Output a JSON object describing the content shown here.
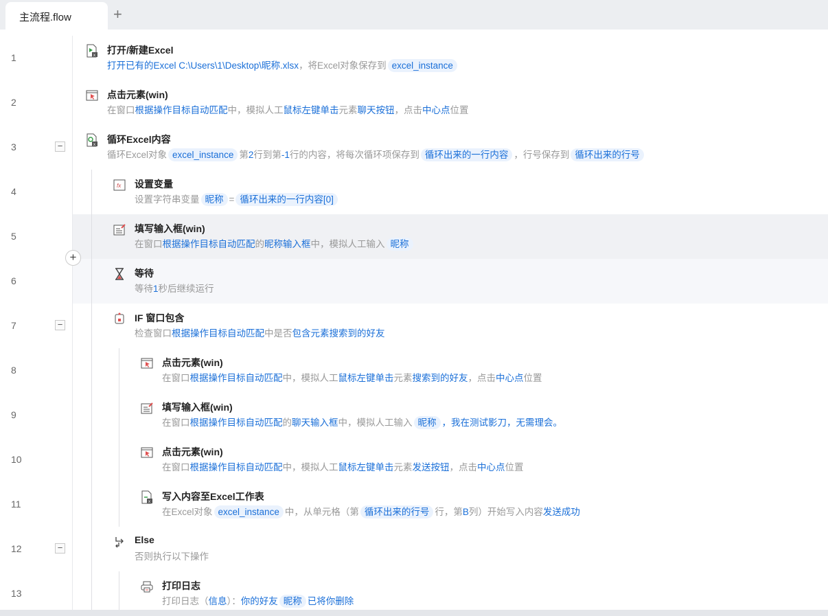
{
  "tabs": [
    {
      "label": "主流程.flow",
      "active": true
    }
  ],
  "add_tab_label": "+",
  "insert_button_label": "+",
  "collapse_label": "−",
  "colors": {
    "link": "#1a6fd8",
    "pill_bg": "#eaf2fd",
    "hover_row": "#f0f1f4",
    "selected_row": "#f6f7fa"
  },
  "steps": [
    {
      "line": "1",
      "level": 0,
      "icon": "excel-open-icon",
      "title": "打开/新建Excel",
      "desc": [
        [
          "b",
          "打开已有的Excel C:\\Users\\1\\Desktop\\昵称.xlsx"
        ],
        [
          "t",
          "，将Excel对象保存到"
        ],
        [
          "p",
          "excel_instance"
        ]
      ]
    },
    {
      "line": "2",
      "level": 0,
      "icon": "click-element-icon",
      "title": "点击元素(win)",
      "desc": [
        [
          "t",
          "在窗口"
        ],
        [
          "b",
          "根据操作目标自动匹配"
        ],
        [
          "t",
          "中，模拟人工"
        ],
        [
          "b",
          "鼠标左键单击"
        ],
        [
          "t",
          "元素"
        ],
        [
          "b",
          "聊天按钮"
        ],
        [
          "t",
          "，点击"
        ],
        [
          "b",
          "中心点"
        ],
        [
          "t",
          "位置"
        ]
      ]
    },
    {
      "line": "3",
      "level": 0,
      "icon": "excel-loop-icon",
      "title": "循环Excel内容",
      "collapsible": true,
      "desc": [
        [
          "t",
          "循环Excel对象"
        ],
        [
          "p",
          "excel_instance"
        ],
        [
          "t",
          "第"
        ],
        [
          "b",
          "2"
        ],
        [
          "t",
          "行到第"
        ],
        [
          "b",
          "-1"
        ],
        [
          "t",
          "行的内容，将每次循环项保存到"
        ],
        [
          "p",
          "循环出来的一行内容"
        ],
        [
          "t",
          "，行号保存到"
        ],
        [
          "p",
          "循环出来的行号"
        ]
      ]
    },
    {
      "line": "4",
      "level": 1,
      "icon": "set-variable-icon",
      "title": "设置变量",
      "desc": [
        [
          "t",
          "设置字符串变量"
        ],
        [
          "p",
          "昵称"
        ],
        [
          "t",
          "="
        ],
        [
          "p",
          "循环出来的一行内容[0]"
        ]
      ]
    },
    {
      "line": "5",
      "level": 1,
      "icon": "fill-input-icon",
      "title": "填写输入框(win)",
      "state": "hover",
      "desc": [
        [
          "t",
          "在窗口"
        ],
        [
          "b",
          "根据操作目标自动匹配"
        ],
        [
          "t",
          "的"
        ],
        [
          "b",
          "昵称输入框"
        ],
        [
          "t",
          "中，模拟人工输入"
        ],
        [
          "p",
          "昵称"
        ]
      ]
    },
    {
      "line": "6",
      "level": 1,
      "icon": "hourglass-icon",
      "title": "等待",
      "state": "selected",
      "desc": [
        [
          "t",
          "等待"
        ],
        [
          "b",
          "1"
        ],
        [
          "t",
          "秒后继续运行"
        ]
      ]
    },
    {
      "line": "7",
      "level": 1,
      "icon": "if-window-icon",
      "title": "IF 窗口包含",
      "collapsible": true,
      "desc": [
        [
          "t",
          "检查窗口"
        ],
        [
          "b",
          "根据操作目标自动匹配"
        ],
        [
          "t",
          "中是否"
        ],
        [
          "b",
          "包含元素搜索到的好友"
        ]
      ]
    },
    {
      "line": "8",
      "level": 2,
      "icon": "click-element-icon",
      "title": "点击元素(win)",
      "desc": [
        [
          "t",
          "在窗口"
        ],
        [
          "b",
          "根据操作目标自动匹配"
        ],
        [
          "t",
          "中，模拟人工"
        ],
        [
          "b",
          "鼠标左键单击"
        ],
        [
          "t",
          "元素"
        ],
        [
          "b",
          "搜索到的好友"
        ],
        [
          "t",
          "，点击"
        ],
        [
          "b",
          "中心点"
        ],
        [
          "t",
          "位置"
        ]
      ]
    },
    {
      "line": "9",
      "level": 2,
      "icon": "fill-input-icon",
      "title": "填写输入框(win)",
      "desc": [
        [
          "t",
          "在窗口"
        ],
        [
          "b",
          "根据操作目标自动匹配"
        ],
        [
          "t",
          "的"
        ],
        [
          "b",
          "聊天输入框"
        ],
        [
          "t",
          "中，模拟人工输入"
        ],
        [
          "p",
          "昵称"
        ],
        [
          "b",
          "，我在测试影刀，无需理会。"
        ]
      ]
    },
    {
      "line": "10",
      "level": 2,
      "icon": "click-element-icon",
      "title": "点击元素(win)",
      "desc": [
        [
          "t",
          "在窗口"
        ],
        [
          "b",
          "根据操作目标自动匹配"
        ],
        [
          "t",
          "中，模拟人工"
        ],
        [
          "b",
          "鼠标左键单击"
        ],
        [
          "t",
          "元素"
        ],
        [
          "b",
          "发送按钮"
        ],
        [
          "t",
          "，点击"
        ],
        [
          "b",
          "中心点"
        ],
        [
          "t",
          "位置"
        ]
      ]
    },
    {
      "line": "11",
      "level": 2,
      "icon": "excel-write-icon",
      "title": "写入内容至Excel工作表",
      "desc": [
        [
          "t",
          "在Excel对象"
        ],
        [
          "p",
          "excel_instance"
        ],
        [
          "t",
          "中，从单元格（第"
        ],
        [
          "p",
          "循环出来的行号"
        ],
        [
          "t",
          "行，第"
        ],
        [
          "b",
          "B"
        ],
        [
          "t",
          "列）开始写入内容"
        ],
        [
          "b",
          "发送成功"
        ]
      ]
    },
    {
      "line": "12",
      "level": 1,
      "icon": "else-branch-icon",
      "title": "Else",
      "collapsible": true,
      "desc": [
        [
          "t",
          "否则执行以下操作"
        ]
      ]
    },
    {
      "line": "13",
      "level": 2,
      "icon": "print-log-icon",
      "title": "打印日志",
      "desc": [
        [
          "t",
          "打印日志（"
        ],
        [
          "b",
          "信息"
        ],
        [
          "t",
          "）："
        ],
        [
          "b",
          "你的好友"
        ],
        [
          "p",
          "昵称"
        ],
        [
          "b",
          "已将你删除"
        ]
      ]
    }
  ]
}
